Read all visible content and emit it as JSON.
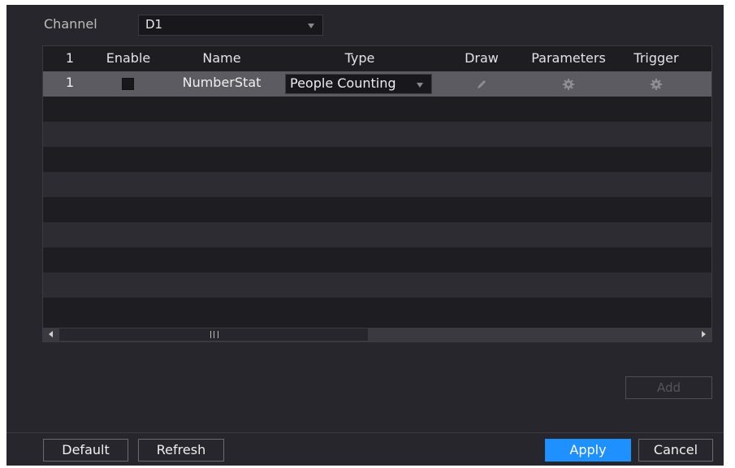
{
  "channel": {
    "label": "Channel",
    "value": "D1"
  },
  "table": {
    "headers": {
      "index": "1",
      "enable": "Enable",
      "name": "Name",
      "type": "Type",
      "draw": "Draw",
      "parameters": "Parameters",
      "trigger": "Trigger"
    },
    "rows": [
      {
        "index": "1",
        "enabled": false,
        "name": "NumberStat",
        "type": "People Counting",
        "draw_icon": "pencil-icon",
        "parameters_icon": "gear-icon",
        "trigger_icon": "gear-icon"
      }
    ]
  },
  "add_label": "Add",
  "footer": {
    "default_label": "Default",
    "refresh_label": "Refresh",
    "apply_label": "Apply",
    "cancel_label": "Cancel"
  },
  "colors": {
    "panel": "#26262c",
    "selected_row": "#5b5b61",
    "accent": "#1e90ff"
  }
}
